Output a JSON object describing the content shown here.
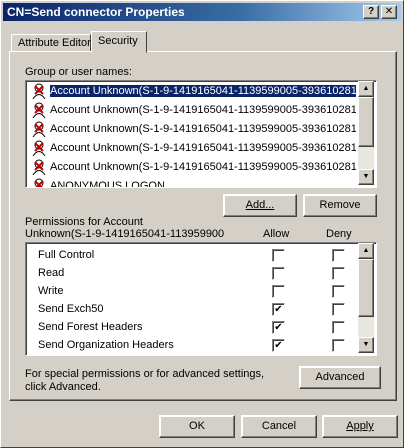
{
  "window": {
    "title": "CN=Send connector Properties",
    "help_glyph": "?",
    "close_glyph": "✕"
  },
  "tabs": [
    {
      "label": "Attribute Editor",
      "active": false
    },
    {
      "label": "Security",
      "active": true
    }
  ],
  "users_section": {
    "label": "Group or user names:",
    "items": [
      {
        "name": "Account Unknown(S-1-9-1419165041-1139599005-393610281...",
        "selected": true
      },
      {
        "name": "Account Unknown(S-1-9-1419165041-1139599005-393610281...",
        "selected": false
      },
      {
        "name": "Account Unknown(S-1-9-1419165041-1139599005-393610281...",
        "selected": false
      },
      {
        "name": "Account Unknown(S-1-9-1419165041-1139599005-393610281...",
        "selected": false
      },
      {
        "name": "Account Unknown(S-1-9-1419165041-1139599005-393610281...",
        "selected": false
      },
      {
        "name": "ANONYMOUS LOGON",
        "selected": false
      }
    ]
  },
  "user_buttons": {
    "add": "Add...",
    "remove": "Remove"
  },
  "permissions": {
    "header_line1": "Permissions for Account",
    "header_line2": "Unknown(S-1-9-1419165041-113959900",
    "allow_label": "Allow",
    "deny_label": "Deny",
    "rows": [
      {
        "name": "Full Control",
        "allow": false,
        "deny": false
      },
      {
        "name": "Read",
        "allow": false,
        "deny": false
      },
      {
        "name": "Write",
        "allow": false,
        "deny": false
      },
      {
        "name": "Send Exch50",
        "allow": true,
        "deny": false
      },
      {
        "name": "Send Forest Headers",
        "allow": true,
        "deny": false
      },
      {
        "name": "Send Organization Headers",
        "allow": true,
        "deny": false
      }
    ]
  },
  "advanced": {
    "text_line1": "For special permissions or for advanced settings,",
    "text_line2": "click Advanced.",
    "button": "Advanced"
  },
  "footer": {
    "ok": "OK",
    "cancel": "Cancel",
    "apply": "Apply"
  },
  "check_glyph": "✔",
  "colors": {
    "title_start": "#0a246a",
    "title_end": "#a6caf0",
    "face": "#d4d0c8",
    "selection": "#0a246a"
  }
}
